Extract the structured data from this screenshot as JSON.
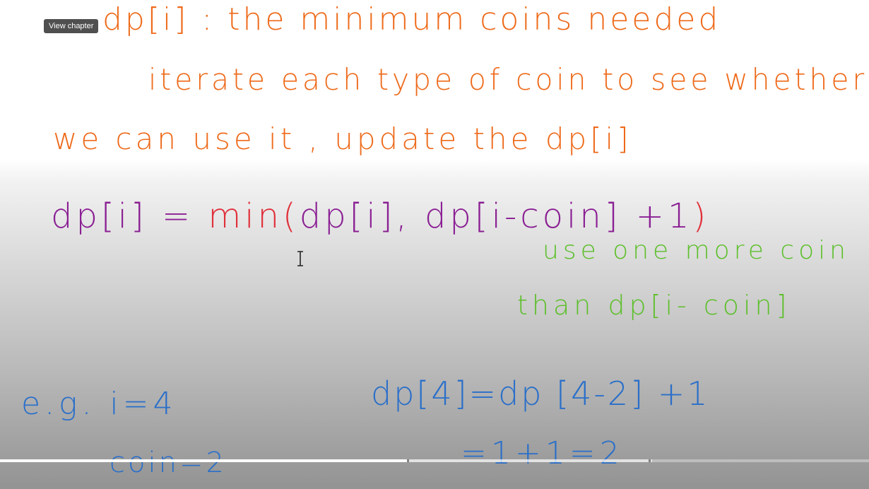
{
  "tooltip": {
    "label": "View chapter"
  },
  "board": {
    "line1": "dp[i] : the minimum coins needed",
    "line2": "iterate each type of coin to see whether",
    "line3": "we can use it , update the dp[i]",
    "line4_lhs": "dp[i] = ",
    "line4_min": "min(",
    "line4_args": "dp[i], dp[i-coin]",
    "line4_plus": " +1",
    "line4_close": ")",
    "note1": "use one more coin",
    "note2": "than dp[i- coin]",
    "example_label": "e.g.  i=4",
    "example_coin": "coin=2",
    "example_eq1": "dp[4]=dp [4-2] +1",
    "example_eq2": "=1+1=2"
  },
  "colors": {
    "orange": "#ee6a1a",
    "purple": "#8a1f93",
    "red": "#e0303a",
    "green": "#5cbf2a",
    "blue": "#2a6fc9"
  },
  "player": {
    "progress_fraction": 0.47,
    "buffered_fraction": 0.75
  }
}
